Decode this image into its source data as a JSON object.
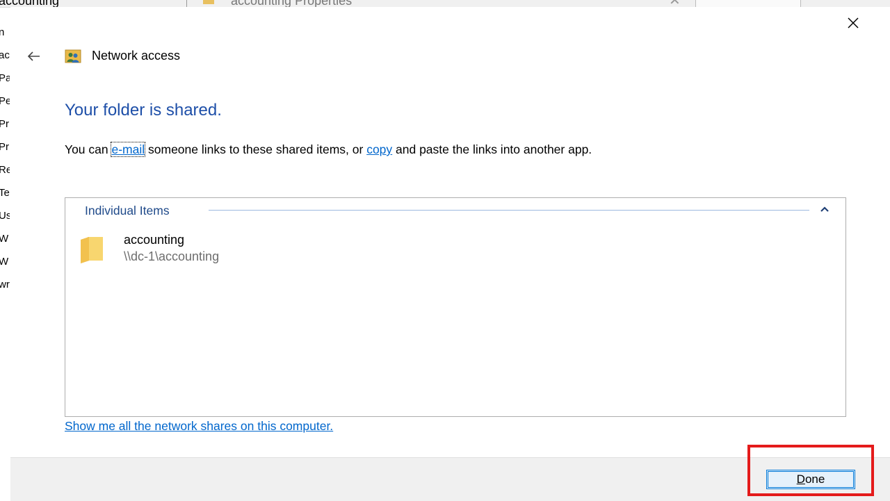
{
  "background_window": {
    "title_left": "accounting",
    "title_right": "accounting Properties",
    "list_fragments": [
      "n",
      "ac",
      "Pa",
      "Pe",
      "Pr",
      "Pr",
      "Re",
      "Te",
      "Us",
      "W",
      "W",
      "wr"
    ]
  },
  "dialog": {
    "header_title": "Network access",
    "headline": "Your folder is shared.",
    "description": {
      "prefix": "You can ",
      "email_link": "e-mail",
      "middle": " someone links to these shared items, or ",
      "copy_link": "copy",
      "suffix": " and paste the links into another app."
    },
    "items_group": {
      "header": "Individual Items",
      "items": [
        {
          "name": "accounting",
          "path": "\\\\dc-1\\accounting"
        }
      ]
    },
    "shares_link": "Show me all the network shares on this computer.",
    "done_button": {
      "mnemonic": "D",
      "rest": "one"
    }
  },
  "colors": {
    "headline": "#1e4fa8",
    "link": "#0066cc",
    "group_header": "#1f4a8a",
    "highlight": "#e41b1b",
    "button_accent": "#0078d7"
  },
  "icons": [
    "close-icon",
    "back-arrow-icon",
    "network-users-icon",
    "chevron-up-icon",
    "folder-icon"
  ]
}
